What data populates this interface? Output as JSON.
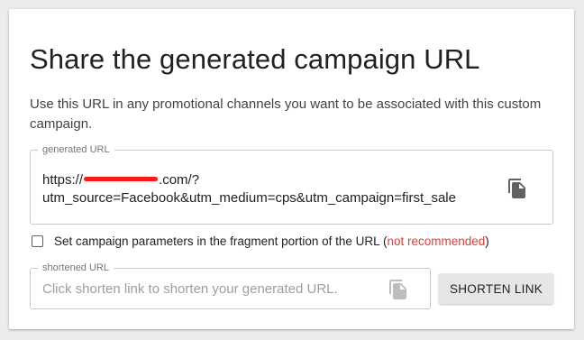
{
  "title": "Share the generated campaign URL",
  "description": "Use this URL in any promotional channels you want to be associated with this custom campaign.",
  "generated_url": {
    "label": "generated URL",
    "value_prefix": "https://",
    "value_suffix": ".com/?utm_source=Facebook&utm_medium=cps&utm_campaign=first_sale",
    "copy_icon": "copy-icon"
  },
  "fragment_option": {
    "label": "Set campaign parameters in the fragment portion of the URL (",
    "warning": "not recommended",
    "close": ")",
    "checked": false
  },
  "shortened_url": {
    "label": "shortened URL",
    "placeholder": "Click shorten link to shorten your generated URL.",
    "copy_icon": "copy-icon"
  },
  "shorten_button": {
    "label": "SHORTEN LINK"
  },
  "colors": {
    "warning": "#e53935",
    "redaction": "#ff1a1a",
    "icon_active": "#616161",
    "icon_disabled": "#bdbdbd"
  }
}
